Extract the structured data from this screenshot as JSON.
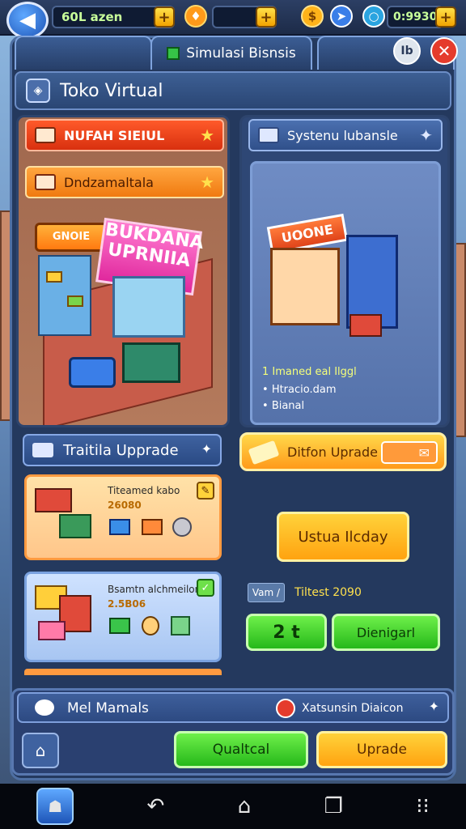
{
  "colors": {
    "accent_green": "#36c447",
    "accent_orange": "#ffa310",
    "frame_blue": "#24395e",
    "close_red": "#e53b2c"
  },
  "topbar": {
    "resource_1": "60L azen",
    "resource_2": "0:9930",
    "icons": [
      "back-arrow-icon",
      "map-pin-icon",
      "coin-icon",
      "paper-plane-icon",
      "ring-icon"
    ]
  },
  "tabs": {
    "main": "Simulasi Bisnsis",
    "side_badge": "Ib"
  },
  "header": {
    "title": "Toko Virtual"
  },
  "left_panel": {
    "banner_1": "NUFAH SIEIUL",
    "banner_2": "Dndzamaltala",
    "sign_text": "BUKDANA UPRNIIA",
    "store_sign": "GNOIE"
  },
  "right_panel": {
    "title": "Systenu lubansle",
    "store_sign": "UOONE",
    "highlight": "1 Imaned eal Ilggl",
    "bullets": [
      "Htracio.dam",
      "Bianal"
    ]
  },
  "upgrades": {
    "header": "Traitila Upprade",
    "cards": [
      {
        "title": "Titeamed kabo",
        "value": "26080"
      },
      {
        "title": "Bsamtn alchmeilon",
        "value": "2.5B06"
      }
    ]
  },
  "actions": {
    "gold_banner": "Ditfon Uprade",
    "main_button": "Ustua Ilcday",
    "label_left": "Vam /",
    "label_right": "Tiltest 2090",
    "count_button": "2 t",
    "confirm_button": "Dienigarl"
  },
  "bottom": {
    "message": "Mel Mamals",
    "status": "Xatsunsin Diaicon",
    "btn_green": "Qualtcal",
    "btn_orange": "Uprade"
  }
}
